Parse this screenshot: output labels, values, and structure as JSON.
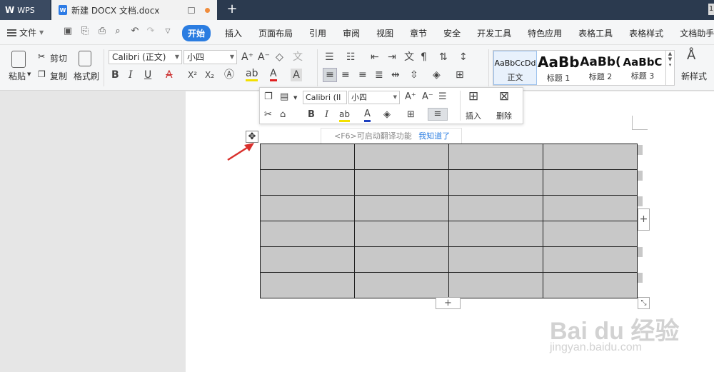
{
  "titlebar": {
    "app_tab": "WPS",
    "doc_tab": "新建 DOCX 文档.docx",
    "doc_icon": "W",
    "new_tab": "+",
    "right_badge": "1"
  },
  "menubar": {
    "file_label": "文件",
    "tabs": [
      "开始",
      "插入",
      "页面布局",
      "引用",
      "审阅",
      "视图",
      "章节",
      "安全",
      "开发工具",
      "特色应用",
      "表格工具",
      "表格样式",
      "文档助手"
    ]
  },
  "ribbon": {
    "paste": "粘贴",
    "cut": "剪切",
    "copy": "复制",
    "format_painter": "格式刷",
    "font_name": "Calibri (正文)",
    "font_size": "小四",
    "bold": "B",
    "italic": "I",
    "underline": "U",
    "superscript": "X²",
    "subscript": "X₂",
    "styles": [
      {
        "sample": "AaBbCcDd",
        "name": "正文"
      },
      {
        "sample": "AaBb",
        "name": "标题 1"
      },
      {
        "sample": "AaBb(",
        "name": "标题 2"
      },
      {
        "sample": "AaBbC",
        "name": "标题 3"
      }
    ],
    "new_style": "新样式"
  },
  "floating_toolbar": {
    "font_name": "Calibri (II",
    "font_size": "小四",
    "bold": "B",
    "italic": "I",
    "insert": "插入",
    "delete": "删除"
  },
  "tip": {
    "text": "<F6>可启动翻译功能",
    "link": "我知道了"
  },
  "table": {
    "rows": 6,
    "cols": 4
  },
  "watermark": {
    "logo": "Bai du 经验",
    "sub": "jingyan.baidu.com"
  },
  "colors": {
    "accent": "#2b7de1",
    "titlebar": "#2b3a4f",
    "cell_fill": "#c8c8c8",
    "arrow": "#d9302c"
  }
}
